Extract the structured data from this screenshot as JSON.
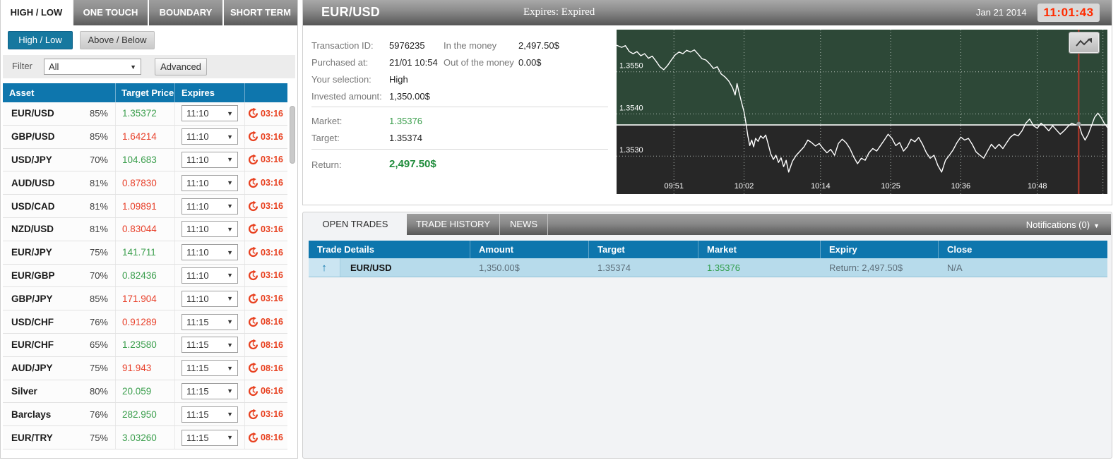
{
  "left_panel": {
    "tabs": [
      {
        "label": "HIGH / LOW",
        "active": true
      },
      {
        "label": "ONE TOUCH",
        "active": false
      },
      {
        "label": "BOUNDARY",
        "active": false
      },
      {
        "label": "SHORT TERM",
        "active": false
      }
    ],
    "mode_buttons": [
      {
        "label": "High / Low",
        "active": true
      },
      {
        "label": "Above / Below",
        "active": false
      }
    ],
    "filter": {
      "label": "Filter",
      "selected": "All",
      "advanced_label": "Advanced"
    },
    "asset_table": {
      "headers": [
        "Asset",
        "Target Price",
        "Expires",
        ""
      ],
      "rows": [
        {
          "asset": "EUR/USD",
          "payout": "85%",
          "price": "1.35372",
          "direction": "up",
          "expiry": "11:10",
          "countdown": "03:16"
        },
        {
          "asset": "GBP/USD",
          "payout": "85%",
          "price": "1.64214",
          "direction": "down",
          "expiry": "11:10",
          "countdown": "03:16"
        },
        {
          "asset": "USD/JPY",
          "payout": "70%",
          "price": "104.683",
          "direction": "up",
          "expiry": "11:10",
          "countdown": "03:16"
        },
        {
          "asset": "AUD/USD",
          "payout": "81%",
          "price": "0.87830",
          "direction": "down",
          "expiry": "11:10",
          "countdown": "03:16"
        },
        {
          "asset": "USD/CAD",
          "payout": "81%",
          "price": "1.09891",
          "direction": "down",
          "expiry": "11:10",
          "countdown": "03:16"
        },
        {
          "asset": "NZD/USD",
          "payout": "81%",
          "price": "0.83044",
          "direction": "down",
          "expiry": "11:10",
          "countdown": "03:16"
        },
        {
          "asset": "EUR/JPY",
          "payout": "75%",
          "price": "141.711",
          "direction": "up",
          "expiry": "11:10",
          "countdown": "03:16"
        },
        {
          "asset": "EUR/GBP",
          "payout": "70%",
          "price": "0.82436",
          "direction": "up",
          "expiry": "11:10",
          "countdown": "03:16"
        },
        {
          "asset": "GBP/JPY",
          "payout": "85%",
          "price": "171.904",
          "direction": "down",
          "expiry": "11:10",
          "countdown": "03:16"
        },
        {
          "asset": "USD/CHF",
          "payout": "76%",
          "price": "0.91289",
          "direction": "down",
          "expiry": "11:15",
          "countdown": "08:16"
        },
        {
          "asset": "EUR/CHF",
          "payout": "65%",
          "price": "1.23580",
          "direction": "up",
          "expiry": "11:15",
          "countdown": "08:16"
        },
        {
          "asset": "AUD/JPY",
          "payout": "75%",
          "price": "91.943",
          "direction": "down",
          "expiry": "11:15",
          "countdown": "08:16"
        },
        {
          "asset": "Silver",
          "payout": "80%",
          "price": "20.059",
          "direction": "up",
          "expiry": "11:15",
          "countdown": "06:16"
        },
        {
          "asset": "Barclays",
          "payout": "76%",
          "price": "282.950",
          "direction": "up",
          "expiry": "11:15",
          "countdown": "03:16"
        },
        {
          "asset": "EUR/TRY",
          "payout": "75%",
          "price": "3.03260",
          "direction": "up",
          "expiry": "11:15",
          "countdown": "08:16"
        }
      ]
    }
  },
  "detail_panel": {
    "title": "EUR/USD",
    "expires_label": "Expires:",
    "expires_value": "Expired",
    "date": "Jan 21 2014",
    "clock": "11:01:43",
    "info_left": [
      {
        "label": "Transaction ID:",
        "value": "5976235"
      },
      {
        "label": "Purchased at:",
        "value": "21/01 10:54"
      },
      {
        "label": "Your selection:",
        "value": "High"
      },
      {
        "label": "Invested amount:",
        "value": "1,350.00$"
      }
    ],
    "info_right": [
      {
        "label": "In the money",
        "value": "2,497.50$"
      },
      {
        "label": "Out of the money",
        "value": "0.00$"
      }
    ],
    "market": {
      "label": "Market:",
      "value": "1.35376"
    },
    "target": {
      "label": "Target:",
      "value": "1.35374"
    },
    "return": {
      "label": "Return:",
      "value": "2,497.50$"
    }
  },
  "chart_data": {
    "type": "line",
    "title": "EUR/USD intraday price",
    "x_ticks": [
      "09:51",
      "10:02",
      "10:14",
      "10:25",
      "10:36",
      "10:48"
    ],
    "x_tick_minutes": [
      9,
      20,
      32,
      43,
      54,
      66
    ],
    "extra_gridline_minutes": [
      76.3
    ],
    "x_domain_minutes": [
      0,
      77
    ],
    "x_domain_start_time": "09:42",
    "y_ticks": [
      1.355,
      1.354,
      1.353
    ],
    "y_tick_labels": [
      "1.3550",
      "1.3540",
      "1.3530"
    ],
    "y_domain": [
      1.3521,
      1.356
    ],
    "target_line": 1.35374,
    "expiry_marker_minute": 72.5,
    "marker_point": {
      "t": 72.5,
      "price": 1.35376
    },
    "legend": "none",
    "grid": "dotted",
    "series": [
      {
        "name": "EUR/USD",
        "points": [
          [
            0,
            1.35563
          ],
          [
            0.8,
            1.35558
          ],
          [
            1.4,
            1.35562
          ],
          [
            2,
            1.35548
          ],
          [
            2.6,
            1.35543
          ],
          [
            3.2,
            1.35548
          ],
          [
            3.8,
            1.35538
          ],
          [
            4.4,
            1.35543
          ],
          [
            5,
            1.35532
          ],
          [
            5.6,
            1.35537
          ],
          [
            6.2,
            1.35525
          ],
          [
            6.8,
            1.35512
          ],
          [
            7.4,
            1.35505
          ],
          [
            8,
            1.35515
          ],
          [
            8.6,
            1.35528
          ],
          [
            9.2,
            1.3554
          ],
          [
            9.8,
            1.35547
          ],
          [
            10.4,
            1.35543
          ],
          [
            11,
            1.35551
          ],
          [
            11.6,
            1.35547
          ],
          [
            12.2,
            1.35552
          ],
          [
            12.8,
            1.35542
          ],
          [
            13.4,
            1.35531
          ],
          [
            14,
            1.35528
          ],
          [
            14.6,
            1.35519
          ],
          [
            15.2,
            1.35508
          ],
          [
            15.8,
            1.35512
          ],
          [
            16.4,
            1.35495
          ],
          [
            17,
            1.35488
          ],
          [
            17.6,
            1.35478
          ],
          [
            18.2,
            1.35462
          ],
          [
            18.6,
            1.35445
          ],
          [
            18.9,
            1.35472
          ],
          [
            19.2,
            1.35452
          ],
          [
            19.6,
            1.35428
          ],
          [
            20,
            1.35405
          ],
          [
            20.3,
            1.35378
          ],
          [
            20.6,
            1.35348
          ],
          [
            20.9,
            1.35325
          ],
          [
            21.2,
            1.35338
          ],
          [
            21.5,
            1.35322
          ],
          [
            21.8,
            1.35342
          ],
          [
            22.2,
            1.35335
          ],
          [
            22.6,
            1.35348
          ],
          [
            23,
            1.35342
          ],
          [
            23.4,
            1.3535
          ],
          [
            23.8,
            1.35328
          ],
          [
            24.2,
            1.35305
          ],
          [
            24.6,
            1.35292
          ],
          [
            25,
            1.35302
          ],
          [
            25.4,
            1.35285
          ],
          [
            25.8,
            1.35296
          ],
          [
            26.2,
            1.35275
          ],
          [
            26.6,
            1.3529
          ],
          [
            27,
            1.35262
          ],
          [
            27.6,
            1.35288
          ],
          [
            28.2,
            1.35302
          ],
          [
            28.8,
            1.35312
          ],
          [
            29.4,
            1.35322
          ],
          [
            30,
            1.35338
          ],
          [
            30.6,
            1.35332
          ],
          [
            31.2,
            1.35324
          ],
          [
            31.8,
            1.3533
          ],
          [
            32.4,
            1.35318
          ],
          [
            33,
            1.35308
          ],
          [
            33.6,
            1.35316
          ],
          [
            34.2,
            1.35302
          ],
          [
            34.8,
            1.3533
          ],
          [
            35.4,
            1.3534
          ],
          [
            36,
            1.35332
          ],
          [
            36.6,
            1.35318
          ],
          [
            37.2,
            1.35298
          ],
          [
            37.8,
            1.35282
          ],
          [
            38.4,
            1.35295
          ],
          [
            39,
            1.3529
          ],
          [
            39.6,
            1.35308
          ],
          [
            40.2,
            1.35318
          ],
          [
            40.8,
            1.35312
          ],
          [
            41.4,
            1.35325
          ],
          [
            42,
            1.35338
          ],
          [
            42.6,
            1.35352
          ],
          [
            43.2,
            1.35342
          ],
          [
            43.8,
            1.35325
          ],
          [
            44.4,
            1.35332
          ],
          [
            45,
            1.35312
          ],
          [
            45.6,
            1.35322
          ],
          [
            46.2,
            1.3534
          ],
          [
            46.8,
            1.35334
          ],
          [
            47.4,
            1.35344
          ],
          [
            48,
            1.35328
          ],
          [
            48.6,
            1.35308
          ],
          [
            49.2,
            1.35295
          ],
          [
            49.8,
            1.35302
          ],
          [
            50.4,
            1.35278
          ],
          [
            51,
            1.35262
          ],
          [
            51.6,
            1.3529
          ],
          [
            52.2,
            1.35302
          ],
          [
            52.8,
            1.35315
          ],
          [
            53.4,
            1.35332
          ],
          [
            54,
            1.35345
          ],
          [
            54.6,
            1.35338
          ],
          [
            55.2,
            1.35342
          ],
          [
            55.8,
            1.35328
          ],
          [
            56.4,
            1.3531
          ],
          [
            57,
            1.35302
          ],
          [
            57.6,
            1.35295
          ],
          [
            58.2,
            1.35312
          ],
          [
            58.8,
            1.35328
          ],
          [
            59.4,
            1.35318
          ],
          [
            60,
            1.35328
          ],
          [
            60.6,
            1.35318
          ],
          [
            61.2,
            1.35332
          ],
          [
            61.8,
            1.35345
          ],
          [
            62.4,
            1.35352
          ],
          [
            63,
            1.35348
          ],
          [
            63.6,
            1.3536
          ],
          [
            64.2,
            1.35378
          ],
          [
            64.8,
            1.35388
          ],
          [
            65.4,
            1.35372
          ],
          [
            66,
            1.35366
          ],
          [
            66.6,
            1.35378
          ],
          [
            67.2,
            1.3537
          ],
          [
            67.8,
            1.3536
          ],
          [
            68.4,
            1.35372
          ],
          [
            69,
            1.35362
          ],
          [
            69.6,
            1.35352
          ],
          [
            70.2,
            1.3536
          ],
          [
            70.8,
            1.3537
          ],
          [
            71.4,
            1.35378
          ],
          [
            72,
            1.35374
          ],
          [
            72.5,
            1.35376
          ],
          [
            73,
            1.35352
          ],
          [
            73.5,
            1.35338
          ],
          [
            74,
            1.35352
          ],
          [
            74.5,
            1.35372
          ],
          [
            75,
            1.35392
          ],
          [
            75.5,
            1.35402
          ],
          [
            76,
            1.35392
          ],
          [
            76.5,
            1.35378
          ],
          [
            77,
            1.35368
          ]
        ]
      }
    ],
    "colors": {
      "above_area": "#2d4837",
      "below_area": "#272727",
      "line": "#ffffff",
      "target_line": "#ffffff",
      "expiry_marker": "#b8392b",
      "marker_dot": "#9a9a9a",
      "grid": "#cfd8d2"
    }
  },
  "bottom_panel": {
    "tabs": [
      {
        "label": "OPEN TRADES",
        "active": true
      },
      {
        "label": "TRADE HISTORY",
        "active": false
      },
      {
        "label": "NEWS",
        "active": false
      }
    ],
    "notifications_label": "Notifications (0)",
    "trades_table": {
      "headers": [
        "Trade Details",
        "Amount",
        "Target",
        "Market",
        "Expiry",
        "Close"
      ],
      "rows": [
        {
          "direction": "up",
          "asset": "EUR/USD",
          "amount": "1,350.00$",
          "target": "1.35374",
          "market": "1.35376",
          "expiry": "Return: 2,497.50$",
          "close": "N/A"
        }
      ]
    }
  },
  "colors": {
    "accent_blue": "#0e76ad",
    "green": "#3a9e4c",
    "red": "#e8402a",
    "timer_red": "#e8401f",
    "clock_red": "#ff2b00",
    "trade_row_blue": "#b7dbeb",
    "mode_button_teal": "#16789f"
  }
}
